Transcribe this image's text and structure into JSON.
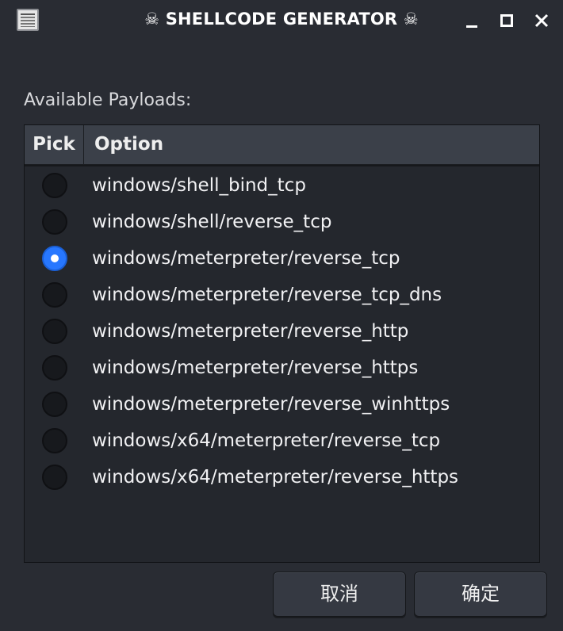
{
  "window": {
    "title": "☠ SHELLCODE GENERATOR ☠",
    "app_icon": "list-icon",
    "controls": [
      "minimize-icon",
      "maximize-icon",
      "close-icon"
    ]
  },
  "payloads_label": "Available Payloads:",
  "table": {
    "headers": {
      "pick": "Pick",
      "option": "Option"
    },
    "rows": [
      {
        "option": "windows/shell_bind_tcp",
        "checked": false
      },
      {
        "option": "windows/shell/reverse_tcp",
        "checked": false
      },
      {
        "option": "windows/meterpreter/reverse_tcp",
        "checked": true
      },
      {
        "option": "windows/meterpreter/reverse_tcp_dns",
        "checked": false
      },
      {
        "option": "windows/meterpreter/reverse_http",
        "checked": false
      },
      {
        "option": "windows/meterpreter/reverse_https",
        "checked": false
      },
      {
        "option": "windows/meterpreter/reverse_winhttps",
        "checked": false
      },
      {
        "option": "windows/x64/meterpreter/reverse_tcp",
        "checked": false
      },
      {
        "option": "windows/x64/meterpreter/reverse_https",
        "checked": false
      }
    ]
  },
  "buttons": {
    "cancel": "取消",
    "ok": "确定"
  },
  "colors": {
    "background": "#292c33",
    "header": "#3b4049",
    "accent": "#2777ff"
  }
}
